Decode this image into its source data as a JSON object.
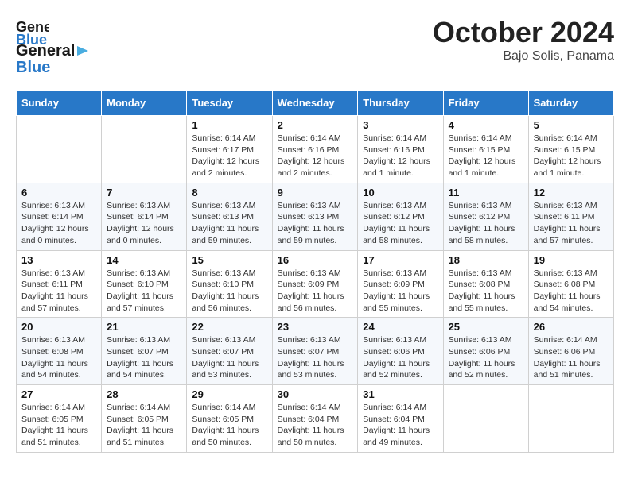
{
  "header": {
    "logo_line1": "General",
    "logo_line2": "Blue",
    "month": "October 2024",
    "location": "Bajo Solis, Panama"
  },
  "days_of_week": [
    "Sunday",
    "Monday",
    "Tuesday",
    "Wednesday",
    "Thursday",
    "Friday",
    "Saturday"
  ],
  "weeks": [
    [
      {
        "date": "",
        "info": ""
      },
      {
        "date": "",
        "info": ""
      },
      {
        "date": "1",
        "info": "Sunrise: 6:14 AM\nSunset: 6:17 PM\nDaylight: 12 hours and 2 minutes."
      },
      {
        "date": "2",
        "info": "Sunrise: 6:14 AM\nSunset: 6:16 PM\nDaylight: 12 hours and 2 minutes."
      },
      {
        "date": "3",
        "info": "Sunrise: 6:14 AM\nSunset: 6:16 PM\nDaylight: 12 hours and 1 minute."
      },
      {
        "date": "4",
        "info": "Sunrise: 6:14 AM\nSunset: 6:15 PM\nDaylight: 12 hours and 1 minute."
      },
      {
        "date": "5",
        "info": "Sunrise: 6:14 AM\nSunset: 6:15 PM\nDaylight: 12 hours and 1 minute."
      }
    ],
    [
      {
        "date": "6",
        "info": "Sunrise: 6:13 AM\nSunset: 6:14 PM\nDaylight: 12 hours and 0 minutes."
      },
      {
        "date": "7",
        "info": "Sunrise: 6:13 AM\nSunset: 6:14 PM\nDaylight: 12 hours and 0 minutes."
      },
      {
        "date": "8",
        "info": "Sunrise: 6:13 AM\nSunset: 6:13 PM\nDaylight: 11 hours and 59 minutes."
      },
      {
        "date": "9",
        "info": "Sunrise: 6:13 AM\nSunset: 6:13 PM\nDaylight: 11 hours and 59 minutes."
      },
      {
        "date": "10",
        "info": "Sunrise: 6:13 AM\nSunset: 6:12 PM\nDaylight: 11 hours and 58 minutes."
      },
      {
        "date": "11",
        "info": "Sunrise: 6:13 AM\nSunset: 6:12 PM\nDaylight: 11 hours and 58 minutes."
      },
      {
        "date": "12",
        "info": "Sunrise: 6:13 AM\nSunset: 6:11 PM\nDaylight: 11 hours and 57 minutes."
      }
    ],
    [
      {
        "date": "13",
        "info": "Sunrise: 6:13 AM\nSunset: 6:11 PM\nDaylight: 11 hours and 57 minutes."
      },
      {
        "date": "14",
        "info": "Sunrise: 6:13 AM\nSunset: 6:10 PM\nDaylight: 11 hours and 57 minutes."
      },
      {
        "date": "15",
        "info": "Sunrise: 6:13 AM\nSunset: 6:10 PM\nDaylight: 11 hours and 56 minutes."
      },
      {
        "date": "16",
        "info": "Sunrise: 6:13 AM\nSunset: 6:09 PM\nDaylight: 11 hours and 56 minutes."
      },
      {
        "date": "17",
        "info": "Sunrise: 6:13 AM\nSunset: 6:09 PM\nDaylight: 11 hours and 55 minutes."
      },
      {
        "date": "18",
        "info": "Sunrise: 6:13 AM\nSunset: 6:08 PM\nDaylight: 11 hours and 55 minutes."
      },
      {
        "date": "19",
        "info": "Sunrise: 6:13 AM\nSunset: 6:08 PM\nDaylight: 11 hours and 54 minutes."
      }
    ],
    [
      {
        "date": "20",
        "info": "Sunrise: 6:13 AM\nSunset: 6:08 PM\nDaylight: 11 hours and 54 minutes."
      },
      {
        "date": "21",
        "info": "Sunrise: 6:13 AM\nSunset: 6:07 PM\nDaylight: 11 hours and 54 minutes."
      },
      {
        "date": "22",
        "info": "Sunrise: 6:13 AM\nSunset: 6:07 PM\nDaylight: 11 hours and 53 minutes."
      },
      {
        "date": "23",
        "info": "Sunrise: 6:13 AM\nSunset: 6:07 PM\nDaylight: 11 hours and 53 minutes."
      },
      {
        "date": "24",
        "info": "Sunrise: 6:13 AM\nSunset: 6:06 PM\nDaylight: 11 hours and 52 minutes."
      },
      {
        "date": "25",
        "info": "Sunrise: 6:13 AM\nSunset: 6:06 PM\nDaylight: 11 hours and 52 minutes."
      },
      {
        "date": "26",
        "info": "Sunrise: 6:14 AM\nSunset: 6:06 PM\nDaylight: 11 hours and 51 minutes."
      }
    ],
    [
      {
        "date": "27",
        "info": "Sunrise: 6:14 AM\nSunset: 6:05 PM\nDaylight: 11 hours and 51 minutes."
      },
      {
        "date": "28",
        "info": "Sunrise: 6:14 AM\nSunset: 6:05 PM\nDaylight: 11 hours and 51 minutes."
      },
      {
        "date": "29",
        "info": "Sunrise: 6:14 AM\nSunset: 6:05 PM\nDaylight: 11 hours and 50 minutes."
      },
      {
        "date": "30",
        "info": "Sunrise: 6:14 AM\nSunset: 6:04 PM\nDaylight: 11 hours and 50 minutes."
      },
      {
        "date": "31",
        "info": "Sunrise: 6:14 AM\nSunset: 6:04 PM\nDaylight: 11 hours and 49 minutes."
      },
      {
        "date": "",
        "info": ""
      },
      {
        "date": "",
        "info": ""
      }
    ]
  ]
}
